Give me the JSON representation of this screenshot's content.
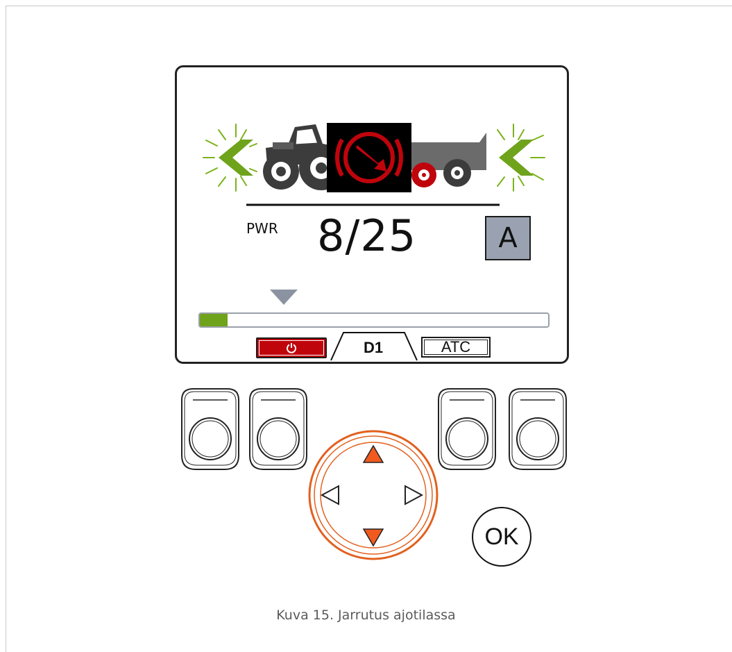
{
  "display": {
    "power_label": "PWR",
    "power_value": "8/25",
    "mode_letter": "A",
    "progress_fraction": 0.08,
    "tabs": {
      "power_icon": "power-icon",
      "d1_label": "D1",
      "atc_label": "ATC"
    },
    "status_icons": [
      "tractor-icon",
      "brake-warning-icon",
      "trailer-icon",
      "left-chevron-blink-icon"
    ]
  },
  "keypad": {
    "ok_label": "OK"
  },
  "caption": "Kuva 15. Jarrutus ajotilassa",
  "colors": {
    "accent_green": "#6fa31b",
    "brake_red": "#c0040c",
    "arrow_orange": "#f05a1e",
    "mode_box": "#9aa2b2"
  }
}
